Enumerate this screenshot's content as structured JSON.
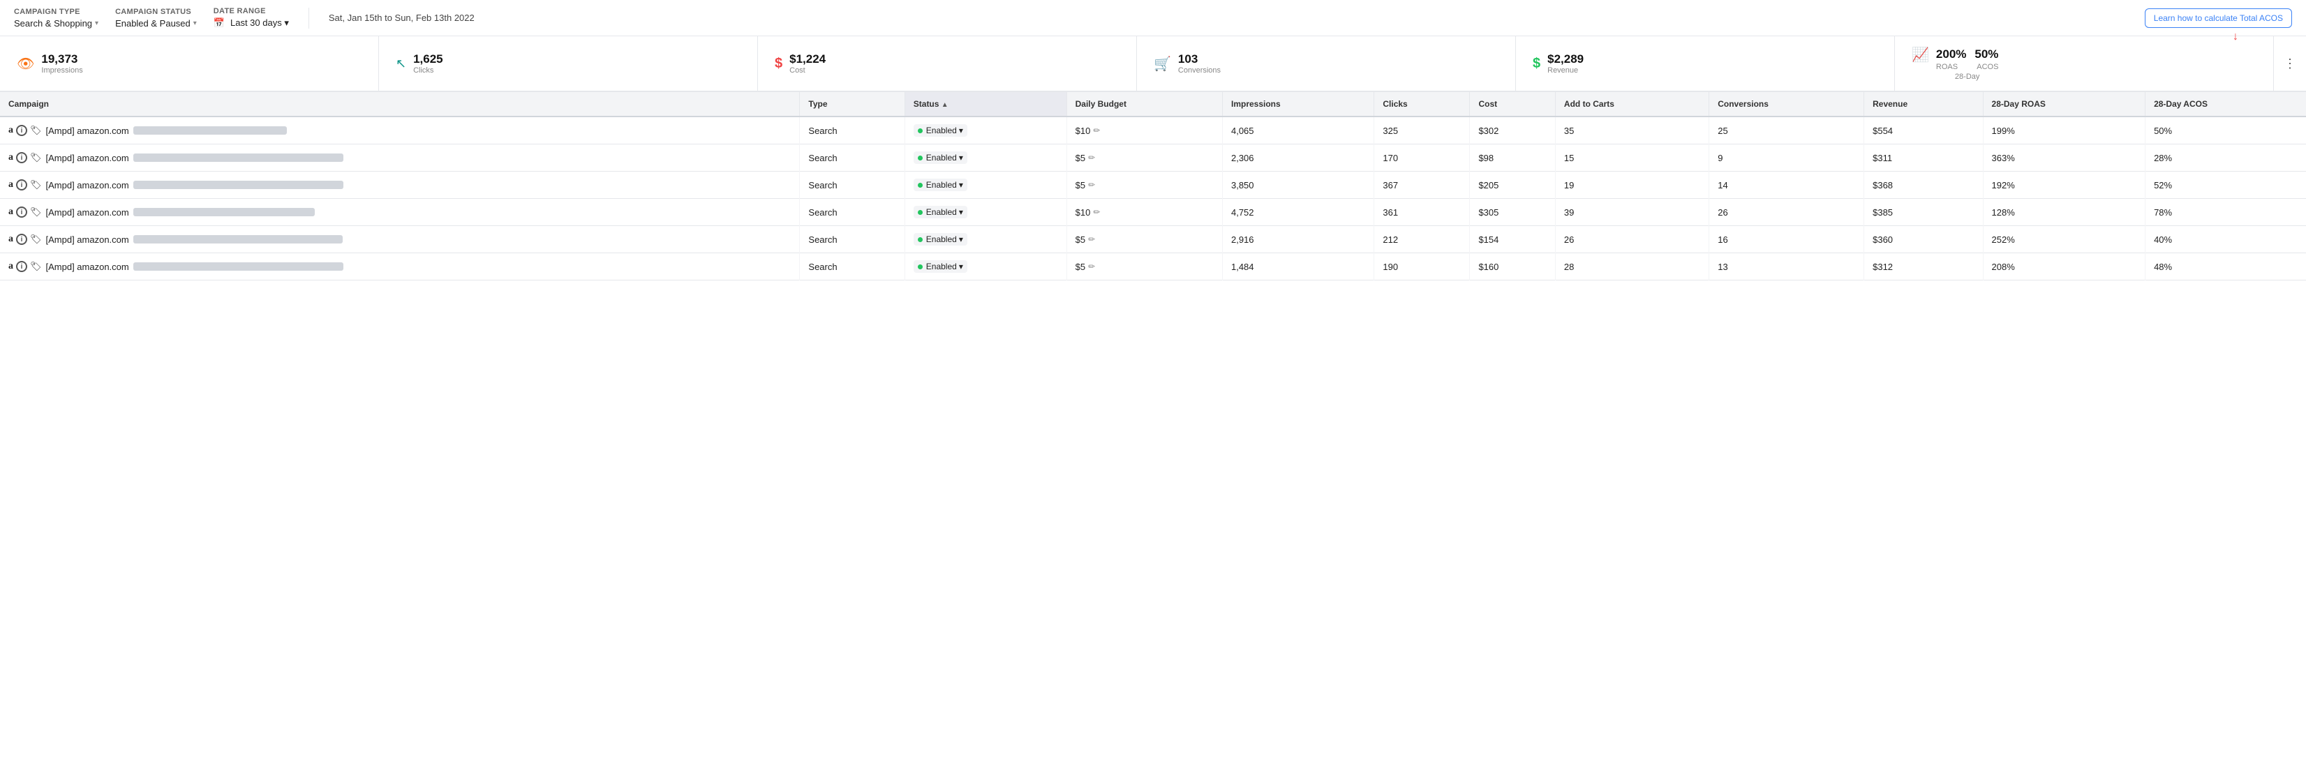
{
  "topBar": {
    "campaignType": {
      "label": "Campaign Type",
      "value": "Search & Shopping",
      "caret": "▾"
    },
    "campaignStatus": {
      "label": "Campaign Status",
      "value": "Enabled & Paused",
      "caret": "▾"
    },
    "dateRange": {
      "label": "Date Range",
      "icon": "📅",
      "value": "Last 30 days",
      "caret": "▾",
      "actual": "Sat, Jan 15th to Sun, Feb 13th 2022"
    },
    "learnBtn": "Learn how to calculate Total ACOS"
  },
  "metrics": [
    {
      "id": "impressions",
      "icon": "👁",
      "iconClass": "orange",
      "value": "19,373",
      "label": "Impressions"
    },
    {
      "id": "clicks",
      "icon": "↖",
      "iconClass": "teal",
      "value": "1,625",
      "label": "Clicks"
    },
    {
      "id": "cost",
      "icon": "$",
      "iconClass": "red",
      "value": "$1,224",
      "label": "Cost"
    },
    {
      "id": "conversions",
      "icon": "🛒",
      "iconClass": "blue",
      "value": "103",
      "label": "Conversions"
    },
    {
      "id": "revenue",
      "icon": "$",
      "iconClass": "green",
      "value": "$2,289",
      "label": "Revenue"
    },
    {
      "id": "roasacos",
      "iconClass": "pink",
      "roas": "200%",
      "acos": "50%",
      "roasLabel": "ROAS",
      "acosLabel": "ACOS",
      "dayLabel": "28-Day"
    }
  ],
  "table": {
    "columns": [
      {
        "id": "campaign",
        "label": "Campaign",
        "sortable": false
      },
      {
        "id": "type",
        "label": "Type",
        "sortable": false
      },
      {
        "id": "status",
        "label": "Status",
        "sortable": true,
        "active": true
      },
      {
        "id": "dailyBudget",
        "label": "Daily Budget",
        "sortable": false
      },
      {
        "id": "impressions",
        "label": "Impressions",
        "sortable": false
      },
      {
        "id": "clicks",
        "label": "Clicks",
        "sortable": false
      },
      {
        "id": "cost",
        "label": "Cost",
        "sortable": false
      },
      {
        "id": "addtocarts",
        "label": "Add to Carts",
        "sortable": false
      },
      {
        "id": "conversions",
        "label": "Conversions",
        "sortable": false
      },
      {
        "id": "revenue",
        "label": "Revenue",
        "sortable": false
      },
      {
        "id": "roas28",
        "label": "28-Day ROAS",
        "sortable": false
      },
      {
        "id": "acos28",
        "label": "28-Day ACOS",
        "sortable": false
      }
    ],
    "rows": [
      {
        "campaign": "[Ampd] amazon.com",
        "blurWidth": "220px",
        "type": "Search",
        "status": "Enabled",
        "budget": "$10",
        "impressions": "4,065",
        "clicks": "325",
        "cost": "$302",
        "addtocarts": "35",
        "conversions": "25",
        "revenue": "$554",
        "roas28": "199%",
        "acos28": "50%"
      },
      {
        "campaign": "[Ampd] amazon.com",
        "blurWidth": "320px",
        "type": "Search",
        "status": "Enabled",
        "budget": "$5",
        "impressions": "2,306",
        "clicks": "170",
        "cost": "$98",
        "addtocarts": "15",
        "conversions": "9",
        "revenue": "$311",
        "roas28": "363%",
        "acos28": "28%"
      },
      {
        "campaign": "[Ampd] amazon.com",
        "blurWidth": "360px",
        "type": "Search",
        "status": "Enabled",
        "budget": "$5",
        "impressions": "3,850",
        "clicks": "367",
        "cost": "$205",
        "addtocarts": "19",
        "conversions": "14",
        "revenue": "$368",
        "roas28": "192%",
        "acos28": "52%"
      },
      {
        "campaign": "[Ampd] amazon.com",
        "blurWidth": "260px",
        "type": "Search",
        "status": "Enabled",
        "budget": "$10",
        "impressions": "4,752",
        "clicks": "361",
        "cost": "$305",
        "addtocarts": "39",
        "conversions": "26",
        "revenue": "$385",
        "roas28": "128%",
        "acos28": "78%"
      },
      {
        "campaign": "[Ampd] amazon.com",
        "blurWidth": "300px",
        "type": "Search",
        "status": "Enabled",
        "budget": "$5",
        "impressions": "2,916",
        "clicks": "212",
        "cost": "$154",
        "addtocarts": "26",
        "conversions": "16",
        "revenue": "$360",
        "roas28": "252%",
        "acos28": "40%"
      },
      {
        "campaign": "[Ampd] amazon.com",
        "blurWidth": "310px",
        "type": "Search",
        "status": "Enabled",
        "budget": "$5",
        "impressions": "1,484",
        "clicks": "190",
        "cost": "$160",
        "addtocarts": "28",
        "conversions": "13",
        "revenue": "$312",
        "roas28": "208%",
        "acos28": "48%"
      }
    ]
  },
  "arrowLabel": "↓",
  "moreOptions": "⋮"
}
